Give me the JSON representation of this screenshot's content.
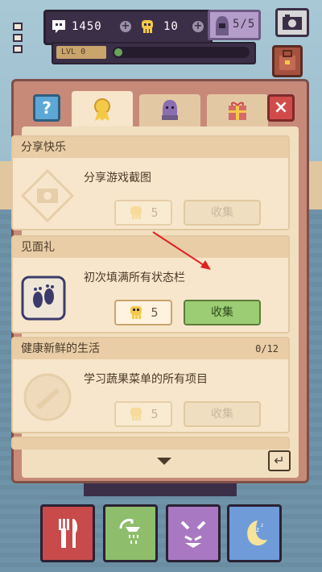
{
  "hud": {
    "currency": "1450",
    "souls": "10",
    "ghosts": "5/5",
    "level_label": "LVL 0",
    "xp_fraction": 0.05
  },
  "tabs": [
    {
      "icon": "medal-icon"
    },
    {
      "icon": "ghost-bust-icon"
    },
    {
      "icon": "gift-icon"
    }
  ],
  "achievements": [
    {
      "title": "分享快乐",
      "desc": "分享游戏截图",
      "reward": "5",
      "collect_label": "收集",
      "icon": "camera-frame-icon",
      "count": "",
      "state": "disabled"
    },
    {
      "title": "见面礼",
      "desc": "初次填满所有状态栏",
      "reward": "5",
      "collect_label": "收集",
      "icon": "footprints-icon",
      "count": "",
      "state": "active"
    },
    {
      "title": "健康新鲜的生活",
      "desc": "学习蔬果菜单的所有项目",
      "reward": "5",
      "collect_label": "收集",
      "icon": "carrot-plate-icon",
      "count": "0/12",
      "state": "disabled"
    }
  ],
  "colors": {
    "panel": "#c78a79",
    "card": "#f7e6cb",
    "collect_active": "#9ccc73",
    "pointer": "#e02020"
  },
  "actions": [
    {
      "icon": "fork-knife-icon",
      "color": "#c94a4a"
    },
    {
      "icon": "shower-icon",
      "color": "#8ebd6b"
    },
    {
      "icon": "devil-face-icon",
      "color": "#a879c2"
    },
    {
      "icon": "moon-sleep-icon",
      "color": "#6f9bd8"
    }
  ]
}
